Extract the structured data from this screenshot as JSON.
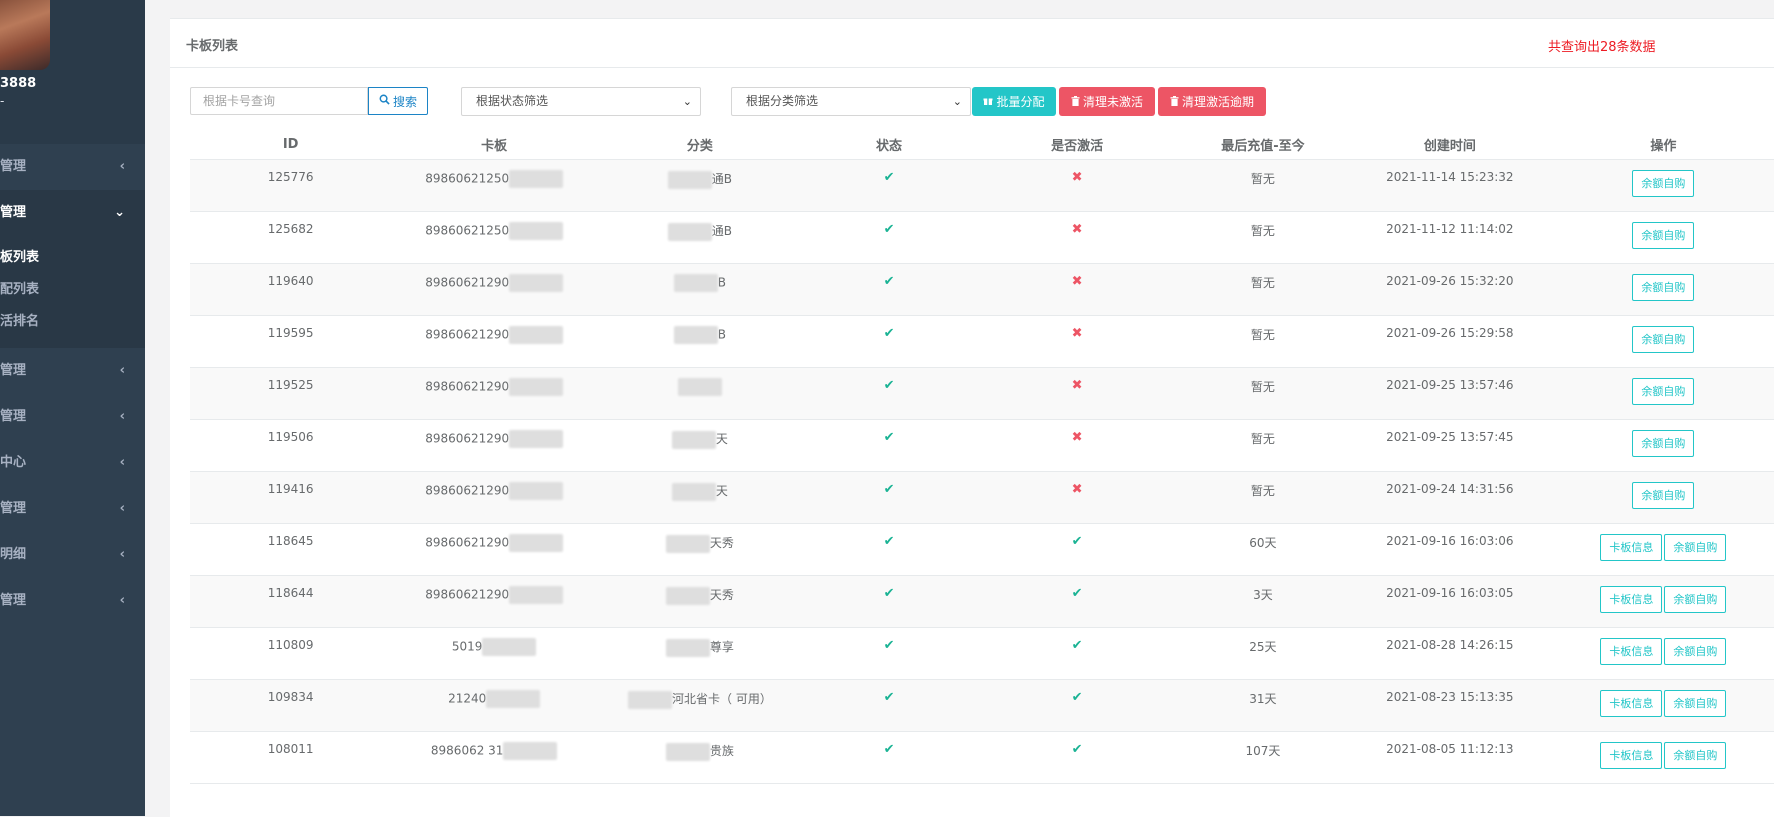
{
  "sidebar": {
    "username": "3888",
    "role": "-",
    "items": [
      {
        "label": "管理",
        "chevron": "‹",
        "active": false
      },
      {
        "label": "管理",
        "chevron": "⌄",
        "active": true
      },
      {
        "label": "管理",
        "chevron": "‹"
      },
      {
        "label": "管理",
        "chevron": "‹"
      },
      {
        "label": "中心",
        "chevron": "‹"
      },
      {
        "label": "管理",
        "chevron": "‹"
      },
      {
        "label": "明细",
        "chevron": "‹"
      },
      {
        "label": "管理",
        "chevron": "‹"
      }
    ],
    "subitems": [
      "板列表",
      "配列表",
      "活排名"
    ]
  },
  "panel": {
    "title": "卡板列表",
    "total": "共查询出28条数据"
  },
  "toolbar": {
    "search_placeholder": "根据卡号查询",
    "search_label": "搜索",
    "status_filter": "根据状态筛选",
    "category_filter": "根据分类筛选",
    "batch_assign": "批量分配",
    "clear_inactive": "清理未激活",
    "clear_expired": "清理激活逾期"
  },
  "table": {
    "headers": [
      "ID",
      "卡板",
      "分类",
      "状态",
      "是否激活",
      "最后充值-至今",
      "创建时间",
      "操作"
    ],
    "rows": [
      {
        "id": "125776",
        "card": "89860621250",
        "category": "通B",
        "status": "✔",
        "activated": "✖",
        "last": "暂无",
        "created": "2021-11-14 15:23:32",
        "info_btn": "",
        "self_btn": "余额自购"
      },
      {
        "id": "125682",
        "card": "89860621250",
        "category": "通B",
        "status": "✔",
        "activated": "✖",
        "last": "暂无",
        "created": "2021-11-12 11:14:02",
        "info_btn": "",
        "self_btn": "余额自购"
      },
      {
        "id": "119640",
        "card": "89860621290",
        "category": "B",
        "status": "✔",
        "activated": "✖",
        "last": "暂无",
        "created": "2021-09-26 15:32:20",
        "info_btn": "",
        "self_btn": "余额自购"
      },
      {
        "id": "119595",
        "card": "89860621290",
        "category": "B",
        "status": "✔",
        "activated": "✖",
        "last": "暂无",
        "created": "2021-09-26 15:29:58",
        "info_btn": "",
        "self_btn": "余额自购"
      },
      {
        "id": "119525",
        "card": "89860621290",
        "category": "",
        "status": "✔",
        "activated": "✖",
        "last": "暂无",
        "created": "2021-09-25 13:57:46",
        "info_btn": "",
        "self_btn": "余额自购"
      },
      {
        "id": "119506",
        "card": "89860621290",
        "category": "天",
        "status": "✔",
        "activated": "✖",
        "last": "暂无",
        "created": "2021-09-25 13:57:45",
        "info_btn": "",
        "self_btn": "余额自购"
      },
      {
        "id": "119416",
        "card": "89860621290",
        "category": "天",
        "status": "✔",
        "activated": "✖",
        "last": "暂无",
        "created": "2021-09-24 14:31:56",
        "info_btn": "",
        "self_btn": "余额自购"
      },
      {
        "id": "118645",
        "card": "89860621290",
        "category": "天秀",
        "status": "✔",
        "activated": "✔",
        "last": "60天",
        "created": "2021-09-16 16:03:06",
        "info_btn": "卡板信息",
        "self_btn": "余额自购"
      },
      {
        "id": "118644",
        "card": "89860621290",
        "category": "天秀",
        "status": "✔",
        "activated": "✔",
        "last": "3天",
        "created": "2021-09-16 16:03:05",
        "info_btn": "卡板信息",
        "self_btn": "余额自购"
      },
      {
        "id": "110809",
        "card": "5019",
        "category": "尊享",
        "status": "✔",
        "activated": "✔",
        "last": "25天",
        "created": "2021-08-28 14:26:15",
        "info_btn": "卡板信息",
        "self_btn": "余额自购"
      },
      {
        "id": "109834",
        "card": "21240",
        "category": "河北省卡（ 可用）",
        "status": "✔",
        "activated": "✔",
        "last": "31天",
        "created": "2021-08-23 15:13:35",
        "info_btn": "卡板信息",
        "self_btn": "余额自购"
      },
      {
        "id": "108011",
        "card": "8986062 31",
        "category": "贵族",
        "status": "✔",
        "activated": "✔",
        "last": "107天",
        "created": "2021-08-05 11:12:13",
        "info_btn": "卡板信息",
        "self_btn": "余额自购"
      }
    ]
  },
  "colors": {
    "sidebar": "#2f4050",
    "primary": "#23c6c8",
    "danger": "#ed5565",
    "success": "#1ab394",
    "total_text": "#ed1c24"
  }
}
